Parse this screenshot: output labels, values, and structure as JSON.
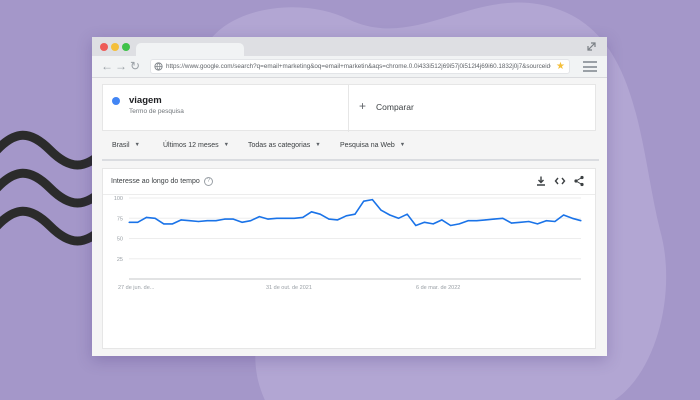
{
  "browser": {
    "url": "https://www.google.com/search?q=email+marketing&oq=email+marketin&aqs=chrome.0.0i433i512j69i57j0i512l4j69i60.1832j0j7&sourceid=chrome&ie=UTF-8"
  },
  "term": {
    "name": "viagem",
    "subtitle": "Termo de pesquisa",
    "color": "#4285f4"
  },
  "compare": {
    "label": "Comparar"
  },
  "filters": {
    "region": "Brasil",
    "period": "Últimos 12 meses",
    "category": "Todas as categorias",
    "search_type": "Pesquisa na Web"
  },
  "chart_header": {
    "title": "Interesse ao longo do tempo",
    "help": "?"
  },
  "icons": [
    "download-icon",
    "embed-icon",
    "share-icon",
    "help-icon",
    "star-icon",
    "menu-icon"
  ],
  "chart_data": {
    "type": "line",
    "title": "Interesse ao longo do tempo",
    "xlabel": "",
    "ylabel": "",
    "ylim": [
      0,
      100
    ],
    "yticks": [
      25,
      50,
      75,
      100
    ],
    "xtick_labels": [
      "27 de jun. de...",
      "31 de out. de 2021",
      "6 de mar. de 2022"
    ],
    "grid": true,
    "series": [
      {
        "color": "#1a73e8",
        "values": [
          70,
          70,
          76,
          75,
          68,
          68,
          73,
          72,
          71,
          72,
          72,
          74,
          74,
          70,
          72,
          77,
          74,
          75,
          75,
          75,
          76,
          83,
          80,
          74,
          73,
          78,
          80,
          96,
          98,
          85,
          79,
          75,
          80,
          66,
          70,
          68,
          73,
          66,
          68,
          72,
          72,
          73,
          74,
          75,
          69,
          70,
          71,
          68,
          72,
          71,
          79,
          75,
          72
        ]
      }
    ]
  }
}
